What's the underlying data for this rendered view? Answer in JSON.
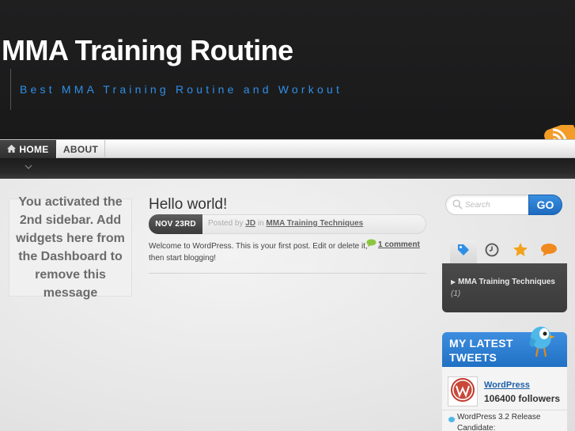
{
  "header": {
    "site_title": "MMA Training Routine",
    "tagline": "Best MMA Training Routine and Workout"
  },
  "nav": {
    "items": [
      {
        "label": "Home",
        "icon": "home-icon",
        "active": true
      },
      {
        "label": "About",
        "active": false
      }
    ]
  },
  "sidebar2": {
    "message": "You activated the 2nd sidebar. Add widgets here from the Dashboard to remove this message"
  },
  "post": {
    "title": "Hello world!",
    "date": "Nov 23rd",
    "meta_posted_by": "Posted by",
    "author": "JD",
    "meta_in": "in",
    "category": "MMA Training Techniques",
    "excerpt": "Welcome to WordPress. This is your first post. Edit or delete it, then start blogging!",
    "comments": "1 comment"
  },
  "search": {
    "placeholder": "Search",
    "button_label": "GO"
  },
  "tabs": {
    "items": [
      {
        "icon": "tag-icon",
        "color": "#2f8fe6"
      },
      {
        "icon": "clock-icon",
        "color": "#555555"
      },
      {
        "icon": "star-icon",
        "color": "#f2a21b"
      },
      {
        "icon": "comment-icon",
        "color": "#f08a1e"
      }
    ]
  },
  "categories": {
    "items": [
      {
        "name": "MMA Training Techniques",
        "count": "(1)"
      }
    ]
  },
  "tweets": {
    "title": "My Latest Tweets",
    "account_name": "WordPress",
    "followers": "106400 followers",
    "latest_tweet": "WordPress 3.2 Release Candidate:"
  },
  "colors": {
    "header_bg": "#1d1d1e",
    "accent_blue": "#2f8fe6",
    "tweets_blue": "#2f80d4",
    "go_button": "#2a7fd6"
  }
}
